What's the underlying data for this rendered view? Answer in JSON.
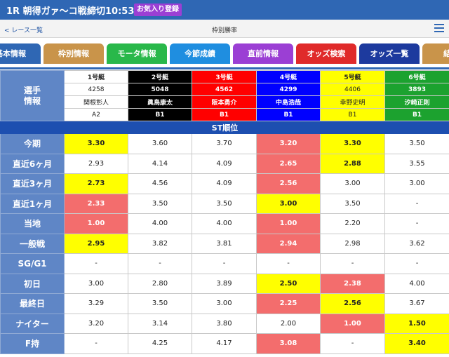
{
  "header": {
    "title": "1R 朝得ガァ〜コ戦",
    "deadline": "締切10:53",
    "favorite_button": "お気入り登録"
  },
  "subbar": {
    "back_link": "< レース一覧",
    "title": "枠別勝率"
  },
  "tabs": [
    {
      "label": "基本情報",
      "color": "#2f67b4"
    },
    {
      "label": "枠別情報",
      "color": "#c9944a"
    },
    {
      "label": "モータ情報",
      "color": "#29b84a"
    },
    {
      "label": "今節成績",
      "color": "#1f8ee0"
    },
    {
      "label": "直前情報",
      "color": "#9b3fd4"
    },
    {
      "label": "オッズ検索",
      "color": "#e02a2a"
    },
    {
      "label": "オッズ一覧",
      "color": "#1d3a9e"
    },
    {
      "label": "結",
      "color": "#c9944a"
    }
  ],
  "player_info": {
    "label": "選手\n情報",
    "boats": [
      {
        "name": "1号艇",
        "number": "4258",
        "player": "関根彰人",
        "class": "A2",
        "bg": "#ffffff",
        "fg": "#222222"
      },
      {
        "name": "2号艇",
        "number": "5048",
        "player": "眞鳥康太",
        "class": "B1",
        "bg": "#000000",
        "fg": "#ffffff"
      },
      {
        "name": "3号艇",
        "number": "4562",
        "player": "阪本勇介",
        "class": "B1",
        "bg": "#ff0000",
        "fg": "#ffffff"
      },
      {
        "name": "4号艇",
        "number": "4299",
        "player": "中島浩哉",
        "class": "B1",
        "bg": "#0000ff",
        "fg": "#ffffff"
      },
      {
        "name": "5号艇",
        "number": "4406",
        "player": "幸野史明",
        "class": "B1",
        "bg": "#ffff00",
        "fg": "#222222"
      },
      {
        "name": "6号艇",
        "number": "3893",
        "player": "汐崎正則",
        "class": "B1",
        "bg": "#1ca22f",
        "fg": "#ffffff"
      }
    ]
  },
  "st_title": "ST順位",
  "rows": [
    {
      "label": "今期",
      "values": [
        "3.30",
        "3.60",
        "3.70",
        "3.20",
        "3.30",
        "3.50"
      ],
      "hl": [
        "y",
        "",
        "",
        "r",
        "y",
        ""
      ]
    },
    {
      "label": "直近6ヶ月",
      "values": [
        "2.93",
        "4.14",
        "4.09",
        "2.65",
        "2.88",
        "3.55"
      ],
      "hl": [
        "",
        "",
        "",
        "r",
        "y",
        ""
      ]
    },
    {
      "label": "直近3ヶ月",
      "values": [
        "2.73",
        "4.56",
        "4.09",
        "2.56",
        "3.00",
        "3.00"
      ],
      "hl": [
        "y",
        "",
        "",
        "r",
        "",
        ""
      ]
    },
    {
      "label": "直近1ヶ月",
      "values": [
        "2.33",
        "3.50",
        "3.50",
        "3.00",
        "3.50",
        "-"
      ],
      "hl": [
        "r",
        "",
        "",
        "y",
        "",
        ""
      ]
    },
    {
      "label": "当地",
      "values": [
        "1.00",
        "4.00",
        "4.00",
        "1.00",
        "2.20",
        "-"
      ],
      "hl": [
        "r",
        "",
        "",
        "r",
        "",
        ""
      ]
    },
    {
      "label": "一般戦",
      "values": [
        "2.95",
        "3.82",
        "3.81",
        "2.94",
        "2.98",
        "3.62"
      ],
      "hl": [
        "y",
        "",
        "",
        "r",
        "",
        ""
      ]
    },
    {
      "label": "SG/G1",
      "values": [
        "-",
        "-",
        "-",
        "-",
        "-",
        "-"
      ],
      "hl": [
        "",
        "",
        "",
        "",
        "",
        ""
      ]
    },
    {
      "label": "初日",
      "values": [
        "3.00",
        "2.80",
        "3.89",
        "2.50",
        "2.38",
        "4.00"
      ],
      "hl": [
        "",
        "",
        "",
        "y",
        "r",
        ""
      ]
    },
    {
      "label": "最終日",
      "values": [
        "3.29",
        "3.50",
        "3.00",
        "2.25",
        "2.56",
        "3.67"
      ],
      "hl": [
        "",
        "",
        "",
        "r",
        "y",
        ""
      ]
    },
    {
      "label": "ナイター",
      "values": [
        "3.20",
        "3.14",
        "3.80",
        "2.00",
        "1.00",
        "1.50"
      ],
      "hl": [
        "",
        "",
        "",
        "",
        "r",
        "y"
      ]
    },
    {
      "label": "F持",
      "values": [
        "-",
        "4.25",
        "4.17",
        "3.08",
        "-",
        "3.40"
      ],
      "hl": [
        "",
        "",
        "",
        "r",
        "",
        "y"
      ]
    }
  ]
}
